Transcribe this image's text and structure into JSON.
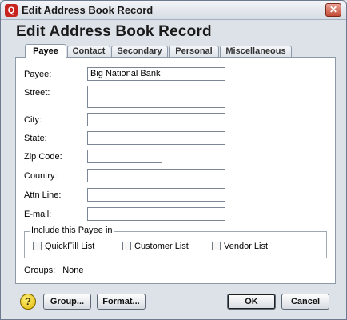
{
  "window": {
    "title": "Edit Address Book Record",
    "app_icon_glyph": "Q",
    "close_glyph": "✕"
  },
  "heading": "Edit Address Book Record",
  "tabs": [
    {
      "label": "Payee",
      "active": true
    },
    {
      "label": "Contact",
      "active": false
    },
    {
      "label": "Secondary",
      "active": false
    },
    {
      "label": "Personal",
      "active": false
    },
    {
      "label": "Miscellaneous",
      "active": false
    }
  ],
  "form": {
    "payee_label": "Payee:",
    "payee_value": "Big National Bank",
    "street_label": "Street:",
    "street_value": "",
    "city_label": "City:",
    "city_value": "",
    "state_label": "State:",
    "state_value": "",
    "zip_label": "Zip Code:",
    "zip_value": "",
    "country_label": "Country:",
    "country_value": "",
    "attn_label": "Attn Line:",
    "attn_value": "",
    "email_label": "E-mail:",
    "email_value": ""
  },
  "include_group": {
    "title": "Include this Payee in",
    "quickfill": {
      "label": "QuickFill List",
      "checked": false
    },
    "customer": {
      "label": "Customer List",
      "checked": false
    },
    "vendor": {
      "label": "Vendor List",
      "checked": false
    }
  },
  "groups": {
    "label": "Groups:",
    "value": "None"
  },
  "buttons": {
    "help_glyph": "?",
    "group": "Group...",
    "format": "Format...",
    "ok": "OK",
    "cancel": "Cancel"
  },
  "colors": {
    "close_button": "#c34b34",
    "app_icon": "#c8231e",
    "help_icon": "#e0b400"
  }
}
